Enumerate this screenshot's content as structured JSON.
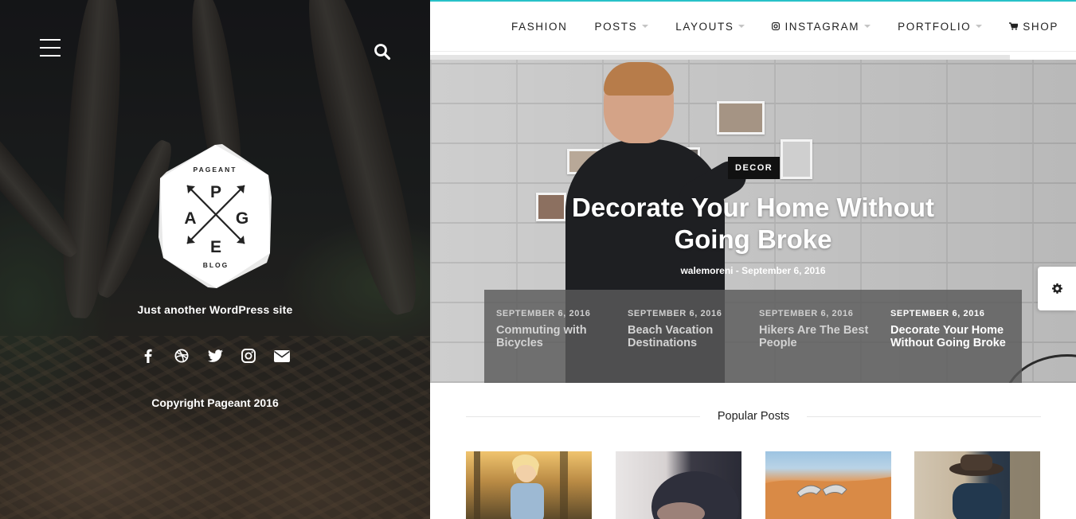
{
  "sidebar": {
    "logo": {
      "top_text": "PAGEANT",
      "letters": [
        "P",
        "A",
        "G",
        "E"
      ],
      "bottom_text": "BLOG"
    },
    "tagline": "Just another WordPress site",
    "social_icons": [
      "facebook-icon",
      "dribbble-icon",
      "twitter-icon",
      "instagram-icon",
      "envelope-icon"
    ],
    "copyright": "Copyright Pageant 2016"
  },
  "nav": {
    "items": [
      {
        "label": "FASHION",
        "caret": false
      },
      {
        "label": "POSTS",
        "caret": true
      },
      {
        "label": "LAYOUTS",
        "caret": true
      },
      {
        "label": "INSTAGRAM",
        "caret": true,
        "icon": "instagram-icon"
      },
      {
        "label": "PORTFOLIO",
        "caret": true
      },
      {
        "label": "SHOP",
        "caret": false,
        "icon": "cart-icon"
      }
    ]
  },
  "hero": {
    "category": "DECOR",
    "title": "Decorate Your Home Without Going Broke",
    "meta": "walemoreni - September 6, 2016"
  },
  "slider": [
    {
      "date": "SEPTEMBER 6, 2016",
      "title": "Commuting with Bicycles",
      "active": false
    },
    {
      "date": "SEPTEMBER 6, 2016",
      "title": "Beach Vacation Destinations",
      "active": false
    },
    {
      "date": "SEPTEMBER 6, 2016",
      "title": "Hikers Are The Best People",
      "active": false
    },
    {
      "date": "SEPTEMBER 6, 2016",
      "title": "Decorate Your Home Without Going Broke",
      "active": true
    }
  ],
  "popular": {
    "heading": "Popular Posts"
  },
  "colors": {
    "accent_line": "#27c1c8",
    "slider_bg": "#5a5a5a",
    "category_bg": "#111111"
  }
}
